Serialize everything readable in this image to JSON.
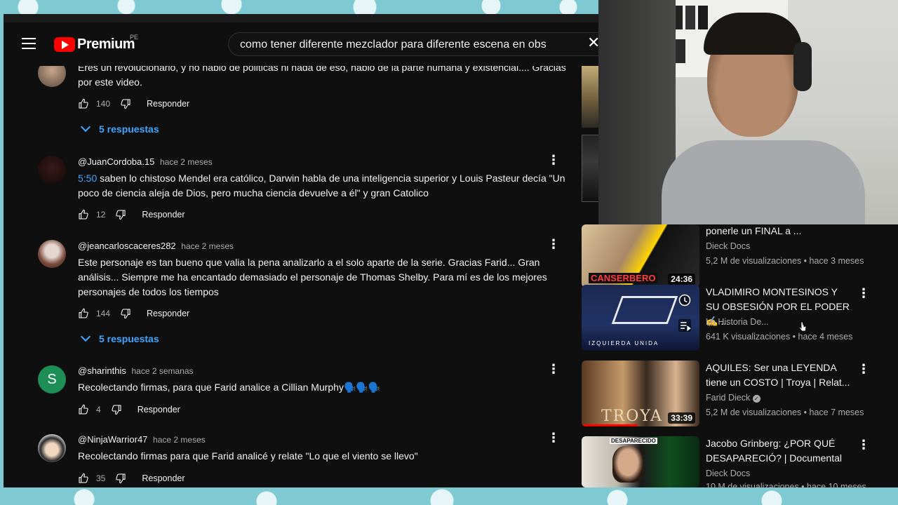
{
  "header": {
    "logo_text": "Premium",
    "region": "PE",
    "search_query": "como tener diferente mezclador para diferente escena en obs",
    "close_symbol": "✕"
  },
  "comments": [
    {
      "text": "Eres un revolucionario, y no hablo de politicas ni nada de eso, hablo de la parte humana y existencial.... Gracias por este video.",
      "likes": "140",
      "reply_label": "Responder",
      "replies_label": "5 respuestas"
    },
    {
      "user": "@JuanCordoba.15",
      "time": "hace 2 meses",
      "timestamp": "5:50",
      "text": " saben lo chistoso Mendel era católico, Darwin habla de una inteligencia superior y Louis Pasteur decía \"Un poco de ciencia aleja de Dios, pero mucha ciencia devuelve a él\" y gran Catolico",
      "likes": "12",
      "reply_label": "Responder"
    },
    {
      "user": "@jeancarloscaceres282",
      "time": "hace 2 meses",
      "text": "Este personaje es tan bueno que valia la pena analizarlo a el solo aparte de la serie. Gracias Farid... Gran análisis... Siempre me ha encantado demasiado el personaje de Thomas Shelby. Para mí es de los mejores personajes de todos los tiempos",
      "likes": "144",
      "reply_label": "Responder",
      "replies_label": "5 respuestas"
    },
    {
      "user": "@sharinthis",
      "time": "hace 2 semanas",
      "avatar_letter": "S",
      "text": "Recolectando firmas, para que Farid analice a Cillian Murphy🗣️🗣️🗣️",
      "likes": "4",
      "reply_label": "Responder"
    },
    {
      "user": "@NinjaWarrior47",
      "time": "hace 2 meses",
      "text": "Recolectando firmas para que Farid analicé y relate \"Lo que el viento se llevo\"",
      "likes": "35",
      "reply_label": "Responder"
    }
  ],
  "sidebar": {
    "videos": [
      {
        "title": "ponerle un FINAL a ...",
        "channel": "Dieck Docs",
        "meta": "5,2 M de visualizaciones • hace 3 meses",
        "duration": "24:36",
        "thumb_caption": "CANSERBERO"
      },
      {
        "title": "VLADIMIRO MONTESINOS Y SU OBSESIÓN POR EL PODER ✍️ ...",
        "channel": "La Historia De...",
        "meta": "641 K visualizaciones • hace 4 meses",
        "thumb_caption": "IZQUIERDA UNIDA"
      },
      {
        "title": "AQUILES: Ser una LEYENDA tiene un COSTO | Troya | Relat...",
        "channel": "Farid Dieck",
        "meta": "5,2 M de visualizaciones • hace 7 meses",
        "duration": "33:39",
        "thumb_caption": "TROYA"
      },
      {
        "title": "Jacobo Grinberg: ¿POR QUÉ DESAPARECIÓ? | Documental",
        "channel": "Dieck Docs",
        "meta": "10 M de visualizaciones • hace 10 meses",
        "thumb_caption": "DESAPARECIDO"
      }
    ]
  },
  "colors": {
    "accent_blue": "#3ea6ff",
    "brand_red": "#ff0000",
    "background": "#0f0f0f"
  }
}
